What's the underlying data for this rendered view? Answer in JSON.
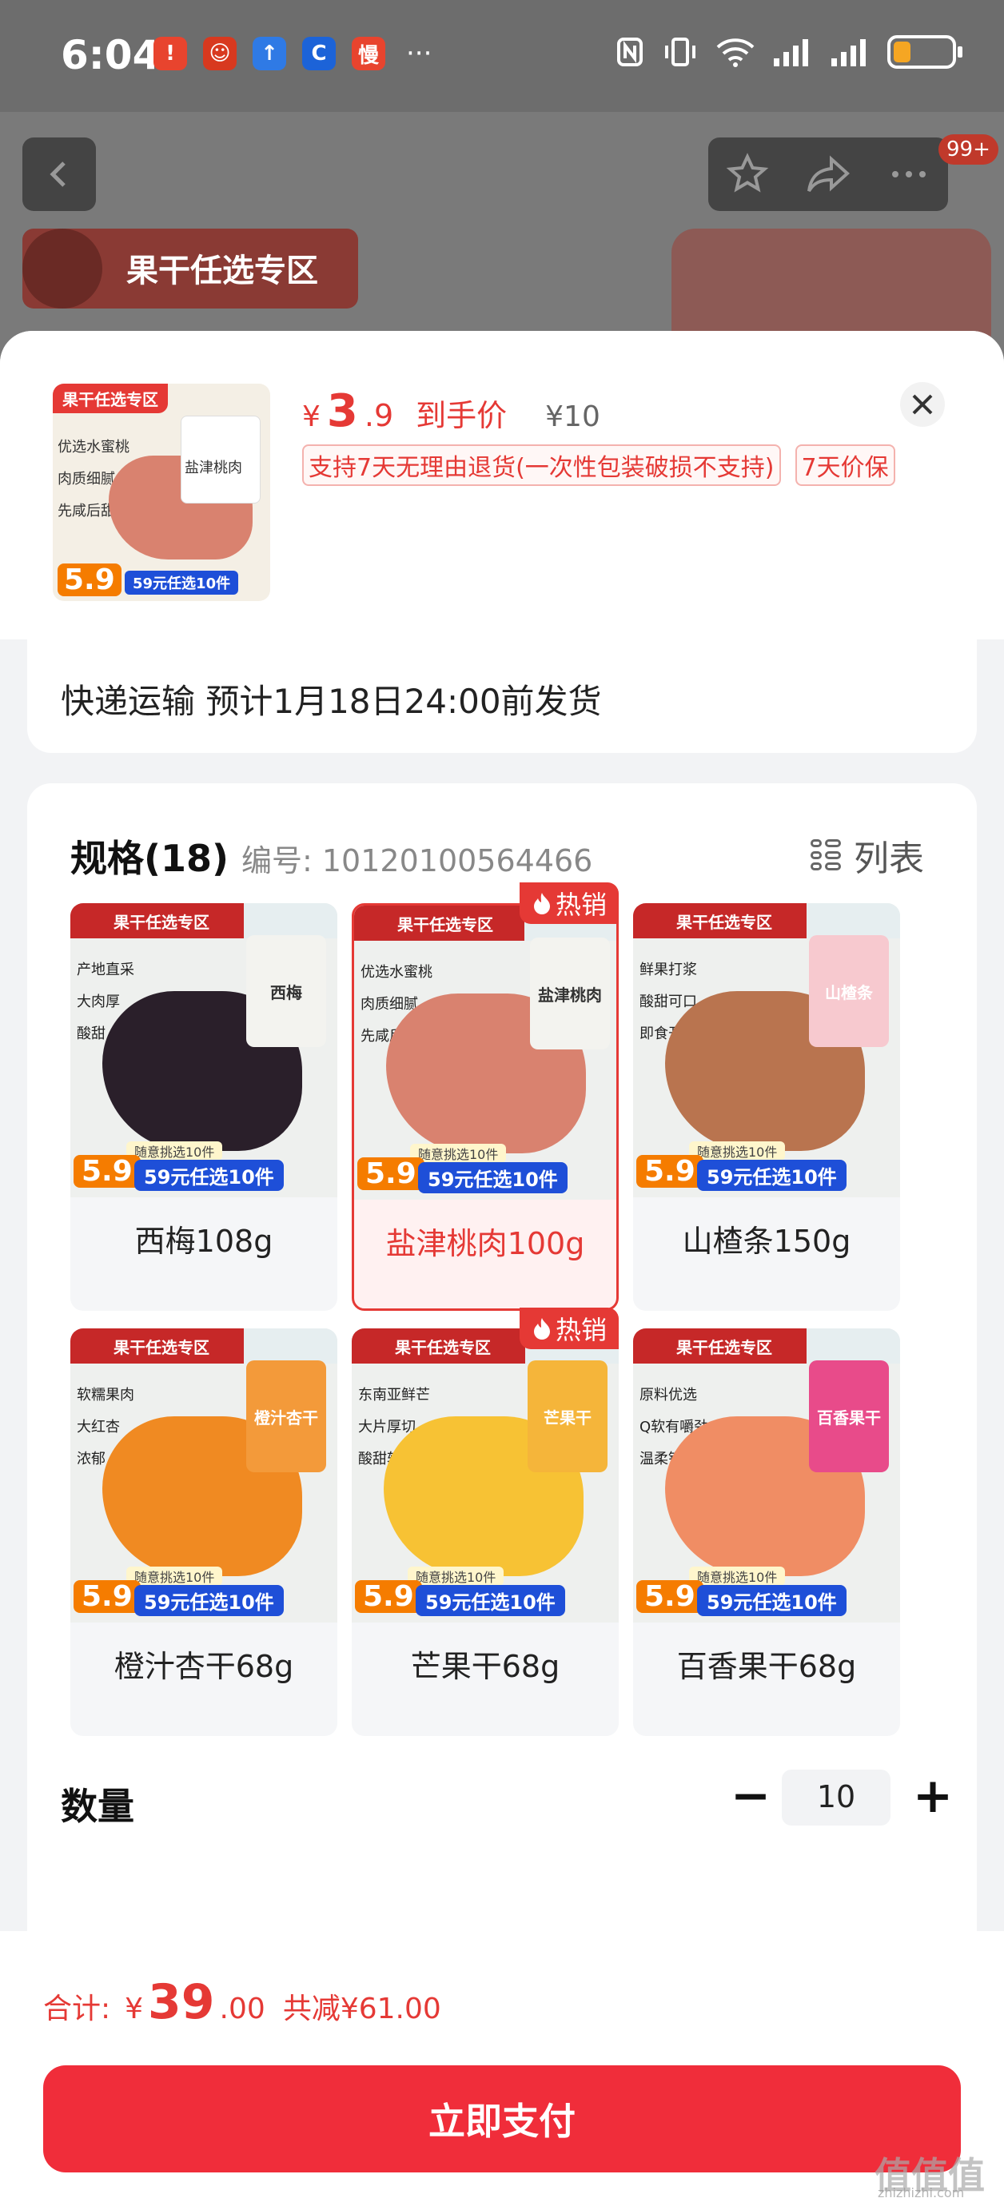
{
  "status": {
    "time": "6:04",
    "apps": [
      {
        "icon": "notification-app-icon",
        "glyph": "!",
        "color": "#e8442e"
      },
      {
        "icon": "mascot-app-icon",
        "glyph": "☺",
        "color": "#d8391f"
      },
      {
        "icon": "upload-app-icon",
        "glyph": "↑",
        "color": "#2f7ae5"
      },
      {
        "icon": "c-app-icon",
        "glyph": "C",
        "color": "#1c63d8"
      },
      {
        "icon": "slow-app-icon",
        "glyph": "慢",
        "color": "#e8442e"
      }
    ],
    "more": "···",
    "battery_level": 0.3
  },
  "background": {
    "badge": "99+",
    "banner_title": "果干任选专区"
  },
  "product": {
    "currency": "¥",
    "price_int": "3",
    "price_dec": ".9",
    "price_label": "到手价",
    "original_price": "¥10",
    "guarantees": [
      "支持7天无理由退货(一次性包装破损不支持)",
      "7天价保"
    ],
    "thumb": {
      "tag": "果干任选专区",
      "bullets": [
        "优选水蜜桃",
        "肉质细腻",
        "先咸后甜"
      ],
      "pack_text": "盐津桃肉",
      "price": "5.9",
      "pick_text": "随意挑选10件",
      "promo": "59元任选10件"
    }
  },
  "delivery": {
    "text": "快递运输 预计1月18日24:00前发货"
  },
  "spec": {
    "title": "规格(18)",
    "code": "编号: 10120100564466",
    "list_label": "列表",
    "hot_label": "热销",
    "items": [
      {
        "name": "西梅108g",
        "tag": "果干任选专区",
        "bullets": [
          "产地直采",
          "大肉厚",
          "酸甜"
        ],
        "bag": "西梅",
        "bag_color": "#f3f3ef",
        "blob_color": "#2a1f2a",
        "price": "5.9",
        "pick": "随意挑选10件",
        "promo": "59元任选10件",
        "selected": false,
        "hot": false
      },
      {
        "name": "盐津桃肉100g",
        "tag": "果干任选专区",
        "bullets": [
          "优选水蜜桃",
          "肉质细腻",
          "先咸后甜"
        ],
        "bag": "盐津桃肉",
        "bag_color": "#f3f3ef",
        "blob_color": "#d9826f",
        "price": "5.9",
        "pick": "随意挑选10件",
        "promo": "59元任选10件",
        "selected": true,
        "hot": true
      },
      {
        "name": "山楂条150g",
        "tag": "果干任选专区",
        "bullets": [
          "鲜果打浆",
          "酸甜可口",
          "即食开味"
        ],
        "bag": "山楂条",
        "bag_color": "#f7c9cf",
        "blob_color": "#b9744f",
        "price": "5.9",
        "pick": "随意挑选10件",
        "promo": "59元任选10件",
        "selected": false,
        "hot": false
      },
      {
        "name": "橙汁杏干68g",
        "tag": "果干任选专区",
        "bullets": [
          "软糯果肉",
          "大红杏",
          "浓郁"
        ],
        "bag": "橙汁杏干",
        "bag_color": "#f39a3a",
        "blob_color": "#f08a22",
        "price": "5.9",
        "pick": "随意挑选10件",
        "promo": "59元任选10件",
        "selected": false,
        "hot": false
      },
      {
        "name": "芒果干68g",
        "tag": "果干任选专区",
        "bullets": [
          "东南亚鲜芒",
          "大片厚切",
          "酸甜软糯"
        ],
        "bag": "芒果干",
        "bag_color": "#f5b53a",
        "blob_color": "#f7c234",
        "price": "5.9",
        "pick": "随意挑选10件",
        "promo": "59元任选10件",
        "selected": false,
        "hot": true
      },
      {
        "name": "百香果干68g",
        "tag": "果干任选专区",
        "bullets": [
          "原料优选",
          "Q软有嚼劲",
          "温柔锁鲜"
        ],
        "bag": "百香果干",
        "bag_color": "#e84b8a",
        "blob_color": "#f08d64",
        "price": "5.9",
        "pick": "随意挑选10件",
        "promo": "59元任选10件",
        "selected": false,
        "hot": false
      }
    ]
  },
  "quantity": {
    "label": "数量",
    "value": "10",
    "minus": "−",
    "plus": "+"
  },
  "footer": {
    "total_label": "合计:",
    "currency": "¥",
    "total_int": "39",
    "total_dec": ".00",
    "savings": "共减¥61.00",
    "pay_label": "立即支付"
  },
  "watermark": {
    "main": "值值值",
    "sub": "zhizhizhi.com"
  }
}
